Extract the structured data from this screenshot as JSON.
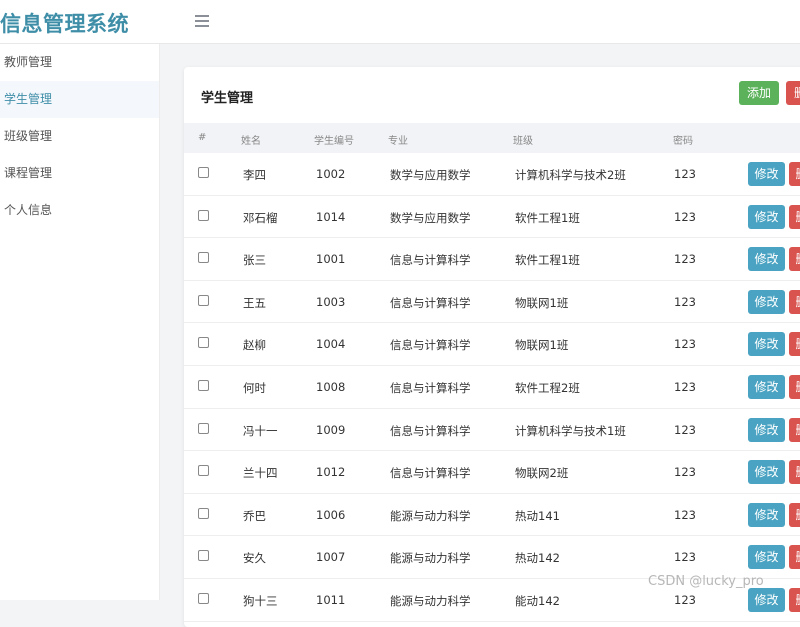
{
  "app": {
    "title": "信息管理系统"
  },
  "sidebar": {
    "items": [
      {
        "label": "教师管理",
        "active": false
      },
      {
        "label": "学生管理",
        "active": true
      },
      {
        "label": "班级管理",
        "active": false
      },
      {
        "label": "课程管理",
        "active": false
      },
      {
        "label": "个人信息",
        "active": false
      }
    ]
  },
  "card": {
    "title": "学生管理",
    "add_label": "添加",
    "delete_label": "删除"
  },
  "table": {
    "headers": [
      "#",
      "姓名",
      "学生编号",
      "专业",
      "班级",
      "密码"
    ],
    "edit_label": "修改",
    "delete_label": "删除",
    "rows": [
      {
        "name": "李四",
        "id": "1002",
        "major": "数学与应用数学",
        "class": "计算机科学与技术2班",
        "password": "123"
      },
      {
        "name": "邓石榴",
        "id": "1014",
        "major": "数学与应用数学",
        "class": "软件工程1班",
        "password": "123"
      },
      {
        "name": "张三",
        "id": "1001",
        "major": "信息与计算科学",
        "class": "软件工程1班",
        "password": "123"
      },
      {
        "name": "王五",
        "id": "1003",
        "major": "信息与计算科学",
        "class": "物联网1班",
        "password": "123"
      },
      {
        "name": "赵柳",
        "id": "1004",
        "major": "信息与计算科学",
        "class": "物联网1班",
        "password": "123"
      },
      {
        "name": "何时",
        "id": "1008",
        "major": "信息与计算科学",
        "class": "软件工程2班",
        "password": "123"
      },
      {
        "name": "冯十一",
        "id": "1009",
        "major": "信息与计算科学",
        "class": "计算机科学与技术1班",
        "password": "123"
      },
      {
        "name": "兰十四",
        "id": "1012",
        "major": "信息与计算科学",
        "class": "物联网2班",
        "password": "123"
      },
      {
        "name": "乔巴",
        "id": "1006",
        "major": "能源与动力科学",
        "class": "热动141",
        "password": "123"
      },
      {
        "name": "安久",
        "id": "1007",
        "major": "能源与动力科学",
        "class": "热动142",
        "password": "123"
      },
      {
        "name": "狗十三",
        "id": "1011",
        "major": "能源与动力科学",
        "class": "能动142",
        "password": "123"
      }
    ]
  },
  "watermark": "CSDN @lucky_pro"
}
